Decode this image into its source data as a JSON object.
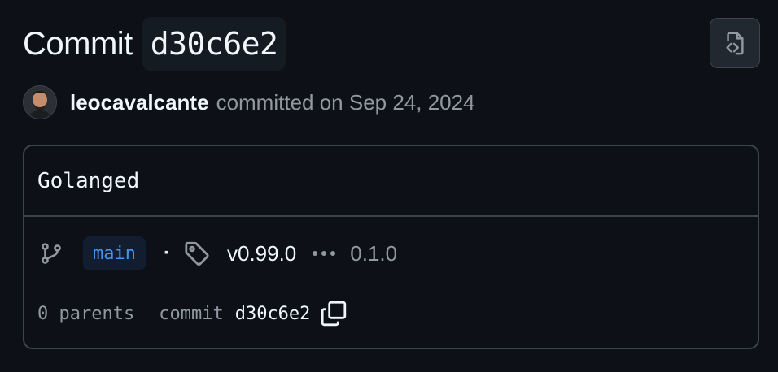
{
  "header": {
    "title_word": "Commit",
    "short_sha": "d30c6e2",
    "browse_button_icon": "file-code-icon"
  },
  "author": {
    "avatar_icon": "avatar",
    "name": "leocavalcante",
    "action_text": "committed on Sep 24, 2024"
  },
  "commit": {
    "message": "Golanged",
    "branch": "main",
    "separator": "·",
    "tag": "v0.99.0",
    "other_tag": "0.1.0",
    "parents_text": "0 parents",
    "commit_label": "commit",
    "sha": "d30c6e2"
  },
  "colors": {
    "background": "#0d1117",
    "border": "#3d444d",
    "text": "#f0f6fc",
    "muted": "#9198a1",
    "accent": "#4493f8"
  }
}
